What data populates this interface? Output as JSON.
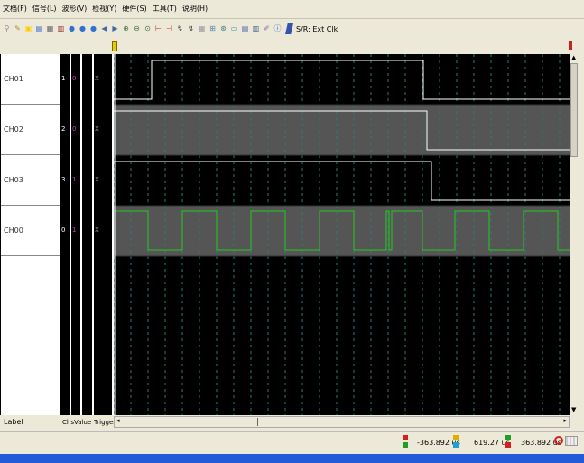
{
  "menu": [
    {
      "label": "文档(F)"
    },
    {
      "label": "信号(L)"
    },
    {
      "label": "波形(V)"
    },
    {
      "label": "检视(Y)"
    },
    {
      "label": "硬件(S)"
    },
    {
      "label": "工具(T)"
    },
    {
      "label": "说明(H)"
    }
  ],
  "toolbar": {
    "sr_label": "S/R: Ext Clk",
    "icons": [
      "key-icon",
      "pen-icon",
      "open-icon",
      "save-icon",
      "print-icon",
      "library-icon",
      "run-icon",
      "stop-icon",
      "step-icon",
      "prev-icon",
      "next-icon",
      "zoom-in-icon",
      "zoom-out-icon",
      "zoom-fit-icon",
      "marker-icon",
      "cursor-icon",
      "flash-icon",
      "tool-icon",
      "grid-icon",
      "trigger-icon",
      "search-icon",
      "chart-icon",
      "layout-icon",
      "bars-icon",
      "probe-icon",
      "info-icon",
      "sr-icon"
    ]
  },
  "channels": [
    {
      "label": "CH01",
      "index": "1",
      "value": "0",
      "trigger": "X"
    },
    {
      "label": "CH02",
      "index": "2",
      "value": "0",
      "trigger": "X"
    },
    {
      "label": "CH03",
      "index": "3",
      "value": "1",
      "trigger": "X"
    },
    {
      "label": "CH00",
      "index": "0",
      "value": "1",
      "trigger": "X"
    }
  ],
  "columns": {
    "label": "Label",
    "chs": "Chs",
    "value": "Value",
    "trigger": "Trigger"
  },
  "status": {
    "a_to_b": "-363.892 us",
    "b_to_a": "619.27 us",
    "a_to_b2": "363.892 us",
    "a_color": "#d02020",
    "b_color": "#20a020",
    "c_color": "#e0b000"
  },
  "colors": {
    "bg": "#000000",
    "wave": "#ffffff",
    "clock": "#22cc22",
    "band": "#555555",
    "grid": "#2a7a7a"
  }
}
